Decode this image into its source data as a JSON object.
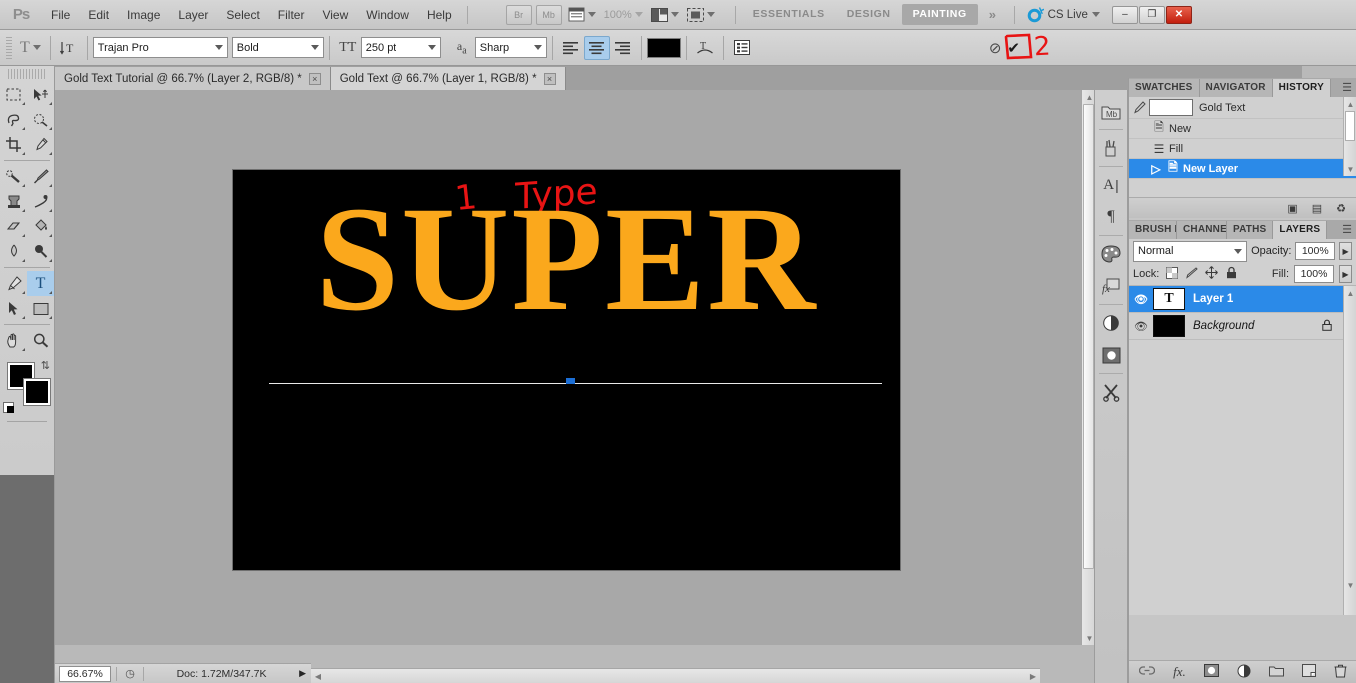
{
  "app": {
    "logo": "Ps",
    "menus": [
      "File",
      "Edit",
      "Image",
      "Layer",
      "Select",
      "Filter",
      "View",
      "Window",
      "Help"
    ],
    "appbar": {
      "bridge": "Br",
      "minibridge": "Mb",
      "view_extras_icon": "view-extras-icon",
      "zoom_level": "100%",
      "arrange_icon": "arrange-documents-icon",
      "screenmode_icon": "screen-mode-icon"
    },
    "workspaces": [
      {
        "label": "ESSENTIALS",
        "active": false
      },
      {
        "label": "DESIGN",
        "active": false
      },
      {
        "label": "PAINTING",
        "active": true
      }
    ],
    "workspace_more": "»",
    "cs_live": "CS Live",
    "window_buttons": {
      "minimize": "–",
      "restore": "❐",
      "close": "✕"
    }
  },
  "options_bar": {
    "tool_icon": "type-tool-icon",
    "orientation_icon": "text-orientation-icon",
    "font_family": "Trajan Pro",
    "font_style": "Bold",
    "size_icon": "font-size-icon",
    "font_size": "250 pt",
    "antialias_icon": "anti-alias-icon",
    "antialias": "Sharp",
    "align": {
      "left": "align-left-icon",
      "center": "align-center-icon",
      "right": "align-right-icon",
      "selected": "center"
    },
    "text_color": "#000000",
    "warp_icon": "warp-text-icon",
    "panel_icon": "character-paragraph-panel-icon",
    "cancel_icon": "⊘",
    "commit_icon": "✔",
    "annotation_number": "2"
  },
  "documents": [
    {
      "title": "Gold Text Tutorial @ 66.7% (Layer 2, RGB/8) *",
      "active": false,
      "close": "×"
    },
    {
      "title": "Gold Text @ 66.7% (Layer 1, RGB/8) *",
      "active": true,
      "close": "×"
    }
  ],
  "toolbar": {
    "tools": [
      {
        "name": "marquee-tool",
        "glyph": "⬚",
        "active": false
      },
      {
        "name": "move-tool",
        "glyph": "➤",
        "active": false
      },
      {
        "name": "lasso-tool",
        "glyph": "✒",
        "active": false
      },
      {
        "name": "quick-selection-tool",
        "glyph": "❁",
        "active": false
      },
      {
        "name": "crop-tool",
        "glyph": "⌗",
        "active": false
      },
      {
        "name": "eyedropper-tool",
        "glyph": "☂",
        "active": false
      },
      {
        "name": "healing-brush-tool",
        "glyph": "✎",
        "active": false
      },
      {
        "name": "brush-tool",
        "glyph": "✏",
        "active": false
      },
      {
        "name": "clone-stamp-tool",
        "glyph": "⚓",
        "active": false
      },
      {
        "name": "history-brush-tool",
        "glyph": "❁",
        "active": false
      },
      {
        "name": "eraser-tool",
        "glyph": "▱",
        "active": false
      },
      {
        "name": "gradient-tool",
        "glyph": "◩",
        "active": false
      },
      {
        "name": "blur-tool",
        "glyph": "○",
        "active": false
      },
      {
        "name": "dodge-tool",
        "glyph": "⚲",
        "active": false
      },
      {
        "name": "pen-tool",
        "glyph": "✑",
        "active": false
      },
      {
        "name": "type-tool",
        "glyph": "T",
        "active": true
      },
      {
        "name": "path-selection-tool",
        "glyph": "➤",
        "active": false
      },
      {
        "name": "rectangle-tool",
        "glyph": "▧",
        "active": false
      },
      {
        "name": "hand-tool",
        "glyph": "✋",
        "active": false
      },
      {
        "name": "zoom-tool",
        "glyph": "⚲",
        "active": false
      }
    ],
    "foreground_color": "#000000",
    "background_color": "#000000",
    "swap_icon": "swap-colors-icon",
    "default_icon": "default-colors-icon"
  },
  "canvas": {
    "document_text": "SUPER",
    "text_color": "#fba81c",
    "background_color": "#000000",
    "annotations": [
      {
        "name": "annotation-step-1",
        "text": "1"
      },
      {
        "name": "annotation-type-label",
        "text": "Type"
      }
    ],
    "annotation_color": "#e81414"
  },
  "status_bar": {
    "zoom": "66.67%",
    "clock_icon": "timer-icon",
    "doc_info": "Doc: 1.72M/347.7K",
    "expand_icon": "▶"
  },
  "dock_strip": [
    {
      "name": "mini-bridge-icon",
      "glyph": "Mb"
    },
    {
      "name": "brush-presets-icon",
      "glyph": "❀"
    },
    {
      "name": "character-panel-icon",
      "glyph": "A"
    },
    {
      "name": "paragraph-panel-icon",
      "glyph": "¶"
    },
    {
      "name": "color-panel-icon",
      "glyph": "◕"
    },
    {
      "name": "styles-panel-icon",
      "glyph": "fx"
    },
    {
      "name": "adjustments-panel-icon",
      "glyph": "◑"
    },
    {
      "name": "masks-panel-icon",
      "glyph": "▣"
    },
    {
      "name": "tools-panel-icon",
      "glyph": "✂"
    }
  ],
  "history_panel": {
    "tabs": [
      {
        "label": "SWATCHES",
        "active": false
      },
      {
        "label": "NAVIGATOR",
        "active": false
      },
      {
        "label": "HISTORY",
        "active": true
      }
    ],
    "menu_icon": "panel-menu-icon",
    "snapshot": {
      "label": "Gold Text",
      "icon": "snapshot-icon"
    },
    "states": [
      {
        "label": "New",
        "icon": "new-state-icon",
        "selected": false
      },
      {
        "label": "Fill",
        "icon": "fill-state-icon",
        "selected": false
      },
      {
        "label": "New Layer",
        "icon": "new-layer-state-icon",
        "selected": true
      }
    ],
    "buttons": [
      {
        "name": "create-document-from-state-button",
        "glyph": "▣"
      },
      {
        "name": "create-snapshot-button",
        "glyph": "▤"
      },
      {
        "name": "delete-state-button",
        "glyph": "♻"
      }
    ]
  },
  "layers_panel": {
    "tabs": [
      {
        "label": "BRUSH P",
        "active": false
      },
      {
        "label": "CHANNE",
        "active": false
      },
      {
        "label": "PATHS",
        "active": false
      },
      {
        "label": "LAYERS",
        "active": true
      }
    ],
    "menu_icon": "panel-menu-icon",
    "blend_mode": "Normal",
    "opacity_label": "Opacity:",
    "opacity_value": "100%",
    "lock_label": "Lock:",
    "lock_icons": [
      {
        "name": "lock-transparent-pixels-icon",
        "glyph": "▦"
      },
      {
        "name": "lock-image-pixels-icon",
        "glyph": "✐"
      },
      {
        "name": "lock-position-icon",
        "glyph": "✥"
      },
      {
        "name": "lock-all-icon",
        "glyph": "ὑ2"
      }
    ],
    "fill_label": "Fill:",
    "fill_value": "100%",
    "layers": [
      {
        "name": "Layer 1",
        "thumb": "T",
        "type": "text",
        "selected": true,
        "locked": false,
        "visible": true
      },
      {
        "name": "Background",
        "thumb": "",
        "type": "image",
        "selected": false,
        "locked": true,
        "visible": true
      }
    ],
    "buttons": [
      {
        "name": "link-layers-button",
        "glyph": "⚭"
      },
      {
        "name": "layer-style-button",
        "glyph": "fx"
      },
      {
        "name": "layer-mask-button",
        "glyph": "▣"
      },
      {
        "name": "adjustment-layer-button",
        "glyph": "◑"
      },
      {
        "name": "new-group-button",
        "glyph": "▱"
      },
      {
        "name": "new-layer-button",
        "glyph": "⧉"
      },
      {
        "name": "delete-layer-button",
        "glyph": "♻"
      }
    ]
  }
}
